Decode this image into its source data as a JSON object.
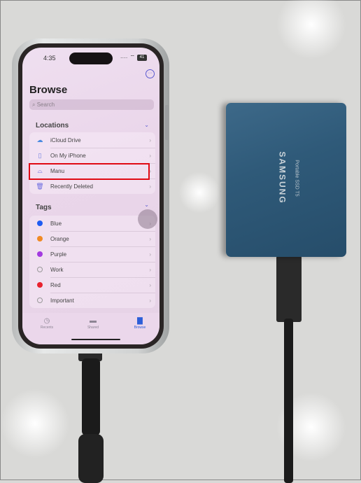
{
  "status_bar": {
    "time": "4:35",
    "signal": "····",
    "wifi": "wifi-icon",
    "battery": "41"
  },
  "header": {
    "title": "Browse",
    "more_icon": "ellipsis-circle-icon"
  },
  "search": {
    "placeholder": "Search"
  },
  "locations": {
    "heading": "Locations",
    "items": [
      {
        "label": "iCloud Drive",
        "icon": "icloud-icon"
      },
      {
        "label": "On My iPhone",
        "icon": "iphone-icon"
      },
      {
        "label": "Manu",
        "icon": "external-drive-icon"
      },
      {
        "label": "Recently Deleted",
        "icon": "trash-icon"
      }
    ]
  },
  "tags": {
    "heading": "Tags",
    "items": [
      {
        "label": "Blue",
        "color": "#1e5cf2"
      },
      {
        "label": "Orange",
        "color": "#f08a24"
      },
      {
        "label": "Purple",
        "color": "#a33ae0"
      },
      {
        "label": "Work",
        "color": ""
      },
      {
        "label": "Red",
        "color": "#e8222e"
      },
      {
        "label": "Important",
        "color": ""
      }
    ]
  },
  "tabbar": {
    "tabs": [
      {
        "label": "Recents",
        "icon": "clock-icon"
      },
      {
        "label": "Shared",
        "icon": "shared-folder-icon"
      },
      {
        "label": "Browse",
        "icon": "folder-icon",
        "active": true
      }
    ],
    "active_color": "#2c5ed8"
  },
  "annotation": {
    "highlight_color": "#e00a14",
    "highlighted_item": "Manu"
  },
  "ssd": {
    "brand": "SAMSUNG",
    "model": "Portable SSD T5"
  }
}
